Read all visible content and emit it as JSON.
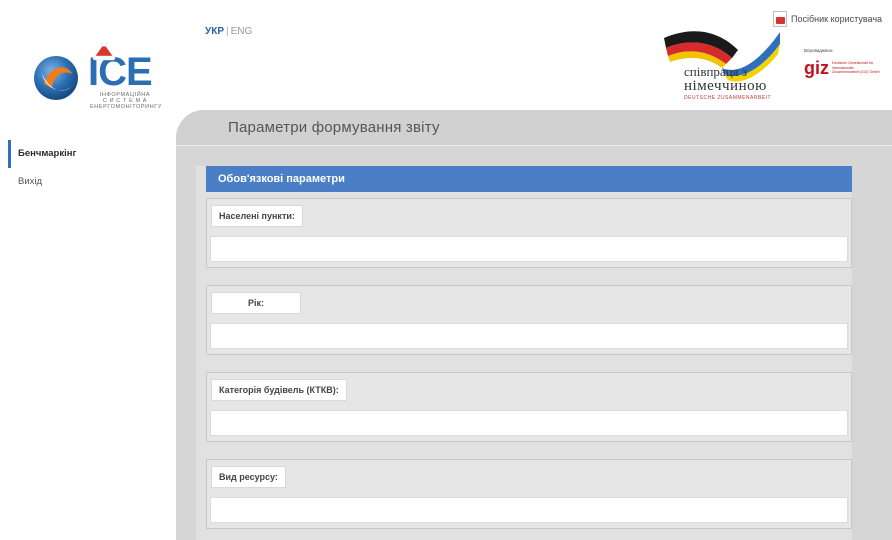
{
  "header": {
    "logo": {
      "title": "ICE",
      "subtitle_lines": [
        "ІНФОРМАЦІЙНА",
        "С И С Т Е М А",
        "ЕНЕРГОМОНІТОРИНГУ"
      ]
    },
    "lang": {
      "active": "УКР",
      "separator": "|",
      "other": "ENG"
    },
    "manual_label": "Посібник користувача",
    "coop": {
      "line1": "співпраця з",
      "line2": "німеччиною",
      "line3": "DEUTSCHE ZUSAMMENARBEIT"
    },
    "giz": {
      "label": "Впроваджено:",
      "logo": "giz",
      "text": "Deutsche Gesellschaft für Internationale Zusammenarbeit (GIZ) GmbH"
    }
  },
  "sidebar": {
    "items": [
      {
        "label": "Бенчмаркінг",
        "active": true
      },
      {
        "label": "Вихід",
        "active": false
      }
    ]
  },
  "main": {
    "title": "Параметри формування звіту",
    "section_title": "Обов'язкові параметри",
    "fields": [
      {
        "label": "Населені пункти:",
        "value": ""
      },
      {
        "label": "Рік:",
        "value": ""
      },
      {
        "label": "Категорія будівель (КТКВ):",
        "value": ""
      },
      {
        "label": "Вид ресурсу:",
        "value": ""
      }
    ]
  },
  "colors": {
    "accent_blue": "#4a7fc6",
    "sidebar_active": "#2f6fbf",
    "panel_gray": "#d6d6d6",
    "giz_red": "#c1121f"
  },
  "icons": [
    "ice-logo-icon",
    "pdf-icon",
    "flag-ribbon-icon"
  ]
}
